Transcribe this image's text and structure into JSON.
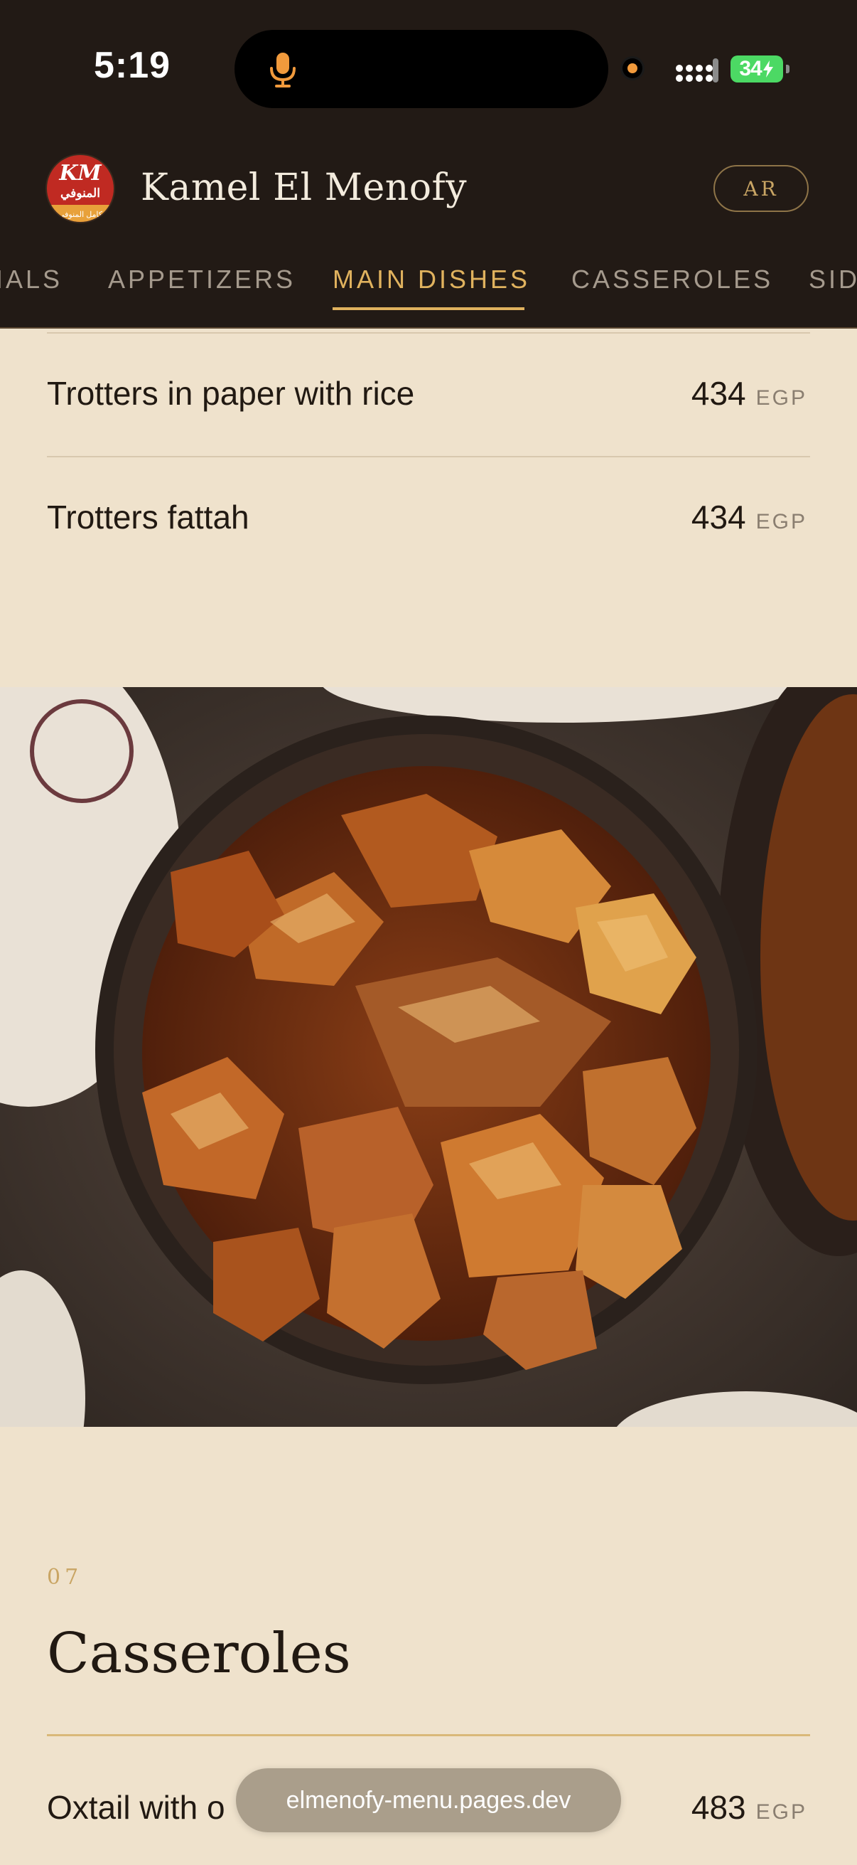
{
  "status_bar": {
    "time": "5:19",
    "battery": "34",
    "mic_color": "#f19a3c"
  },
  "header": {
    "brand": "Kamel El Menofy",
    "logo": {
      "mark": "KM",
      "arabic": "المنوفي",
      "arabic_sub": "كامل المنوفي"
    },
    "lang_button": "AR"
  },
  "tabs": [
    {
      "label": "IALS",
      "active": false
    },
    {
      "label": "APPETIZERS",
      "active": false
    },
    {
      "label": "MAIN DISHES",
      "active": true
    },
    {
      "label": "CASSEROLES",
      "active": false
    },
    {
      "label": "SID",
      "active": false
    }
  ],
  "menu_items": [
    {
      "name": "Trotters in paper with rice",
      "price": "434",
      "currency": "EGP"
    },
    {
      "name": "Trotters fattah",
      "price": "434",
      "currency": "EGP"
    }
  ],
  "section": {
    "number": "07",
    "title": "Casseroles",
    "items": [
      {
        "name": "Oxtail with o",
        "price": "483",
        "currency": "EGP"
      }
    ]
  },
  "browser": {
    "url": "elmenofy-menu.pages.dev"
  },
  "colors": {
    "header_bg": "#221a15",
    "page_bg": "#efe2cc",
    "accent_gold": "#e0b25e"
  }
}
